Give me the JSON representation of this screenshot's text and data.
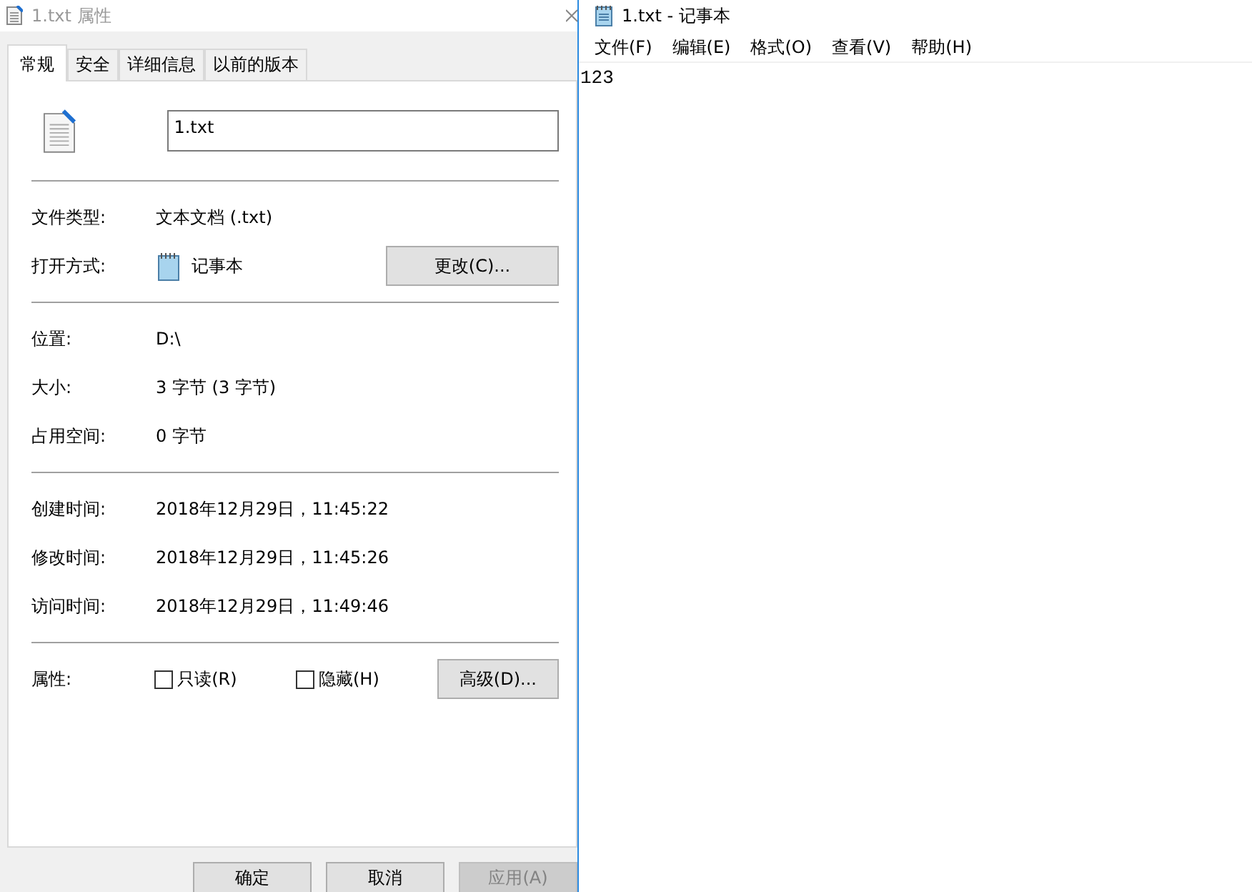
{
  "properties_window": {
    "title": "1.txt 属性",
    "tabs": [
      {
        "label": "常规",
        "selected": true
      },
      {
        "label": "安全",
        "selected": false
      },
      {
        "label": "详细信息",
        "selected": false
      },
      {
        "label": "以前的版本",
        "selected": false
      }
    ],
    "file_name": "1.txt",
    "sections": [
      [
        {
          "kind": "text",
          "label": "文件类型:",
          "value": "文本文档 (.txt)"
        },
        {
          "kind": "app",
          "label": "打开方式:",
          "value": "记事本",
          "button": "更改(C)..."
        }
      ],
      [
        {
          "kind": "text",
          "label": "位置:",
          "value": "D:\\"
        },
        {
          "kind": "text",
          "label": "大小:",
          "value": "3 字节 (3 字节)"
        },
        {
          "kind": "text",
          "label": "占用空间:",
          "value": "0 字节"
        }
      ],
      [
        {
          "kind": "text",
          "label": "创建时间:",
          "value": "2018年12月29日，11:45:22"
        },
        {
          "kind": "text",
          "label": "修改时间:",
          "value": "2018年12月29日，11:45:26"
        },
        {
          "kind": "text",
          "label": "访问时间:",
          "value": "2018年12月29日，11:49:46"
        }
      ]
    ],
    "attributes": {
      "label": "属性:",
      "checkboxes": [
        {
          "label": "只读(R)",
          "checked": false
        },
        {
          "label": "隐藏(H)",
          "checked": false
        }
      ],
      "button": "高级(D)..."
    },
    "buttons": [
      {
        "label": "确定",
        "disabled": false
      },
      {
        "label": "取消",
        "disabled": false
      },
      {
        "label": "应用(A)",
        "disabled": true
      }
    ]
  },
  "notepad": {
    "title": "1.txt - 记事本",
    "menu": [
      "文件(F)",
      "编辑(E)",
      "格式(O)",
      "查看(V)",
      "帮助(H)"
    ],
    "content": "123"
  }
}
